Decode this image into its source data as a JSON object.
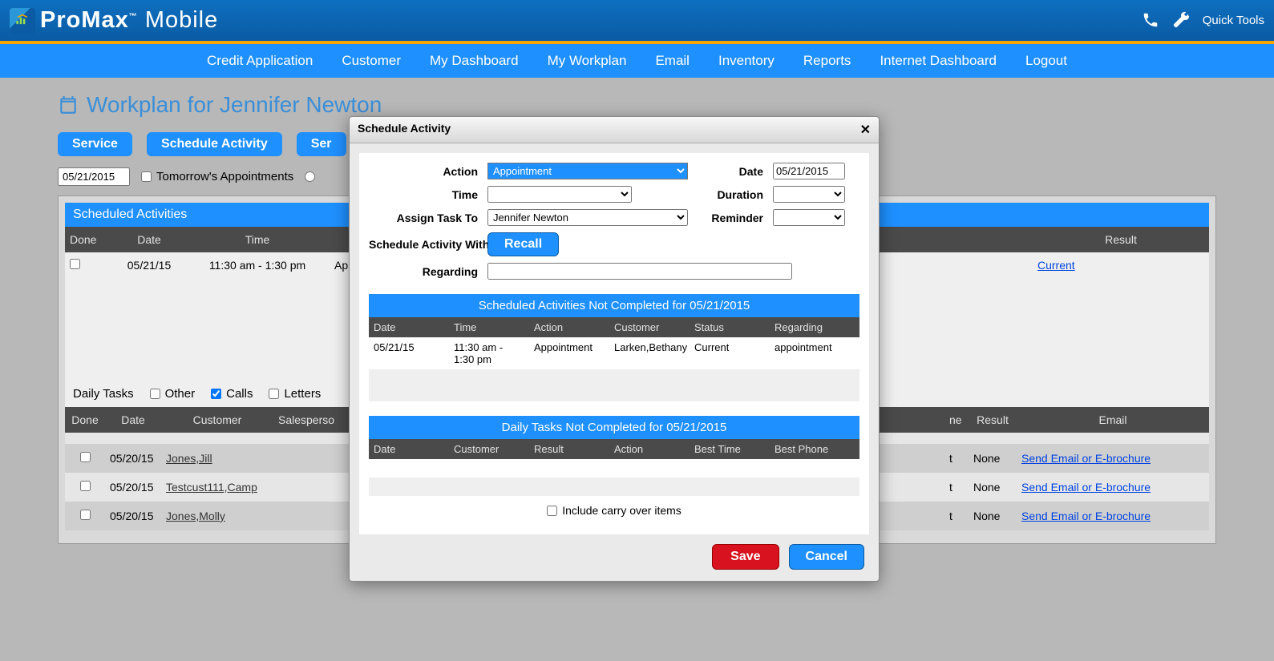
{
  "header": {
    "brand_a": "ProMax",
    "brand_tm": "™",
    "brand_b": "Mobile",
    "quick_tools": "Quick Tools"
  },
  "nav": [
    "Credit Application",
    "Customer",
    "My Dashboard",
    "My Workplan",
    "Email",
    "Inventory",
    "Reports",
    "Internet Dashboard",
    "Logout"
  ],
  "title": "Workplan for Jennifer Newton",
  "buttons": {
    "service": "Service",
    "schedule": "Schedule Activity",
    "ser": "Ser"
  },
  "filters": {
    "date": "05/21/2015",
    "tomorrow": "Tomorrow's Appointments"
  },
  "sched": {
    "title": "Scheduled Activities",
    "cols": {
      "done": "Done",
      "date": "Date",
      "time": "Time",
      "result": "Result"
    },
    "row": {
      "date": "05/21/15",
      "time": "11:30 am - 1:30 pm",
      "ap": "Ap",
      "result": "Current"
    }
  },
  "daily": {
    "title": "Daily Tasks",
    "other": "Other",
    "calls": "Calls",
    "letters": "Letters",
    "cols": {
      "done": "Done",
      "date": "Date",
      "cust": "Customer",
      "sales": "Salesperso",
      "ne": "ne",
      "result": "Result",
      "email": "Email"
    },
    "rows": [
      {
        "date": "05/20/15",
        "cust": "Jones,Jill",
        "ne": "t",
        "result": "None",
        "email": "Send Email or E-brochure"
      },
      {
        "date": "05/20/15",
        "cust": "Testcust111,Camp",
        "ne": "t",
        "result": "None",
        "email": "Send Email or E-brochure"
      },
      {
        "date": "05/20/15",
        "cust": "Jones,Molly",
        "ne": "t",
        "result": "None",
        "email": "Send Email or E-brochure"
      }
    ]
  },
  "modal": {
    "title": "Schedule Activity",
    "labels": {
      "action": "Action",
      "date": "Date",
      "time": "Time",
      "duration": "Duration",
      "assign": "Assign Task To",
      "reminder": "Reminder",
      "schedule_with": "Schedule Activity With",
      "regarding": "Regarding"
    },
    "values": {
      "action": "Appointment",
      "date": "05/21/2015",
      "assign": "Jennifer Newton"
    },
    "recall": "Recall",
    "sub1": "Scheduled Activities Not Completed for 05/21/2015",
    "sub1cols": {
      "date": "Date",
      "time": "Time",
      "action": "Action",
      "cust": "Customer",
      "status": "Status",
      "reg": "Regarding"
    },
    "sub1row": {
      "date": "05/21/15",
      "time": "11:30 am - 1:30 pm",
      "action": "Appointment",
      "cust": "Larken,Bethany",
      "status": "Current",
      "reg": "appointment"
    },
    "sub2": "Daily Tasks Not Completed for 05/21/2015",
    "sub2cols": {
      "date": "Date",
      "cust": "Customer",
      "result": "Result",
      "action": "Action",
      "best_time": "Best Time",
      "best_phone": "Best Phone"
    },
    "carry": "Include carry over items",
    "save": "Save",
    "cancel": "Cancel"
  }
}
